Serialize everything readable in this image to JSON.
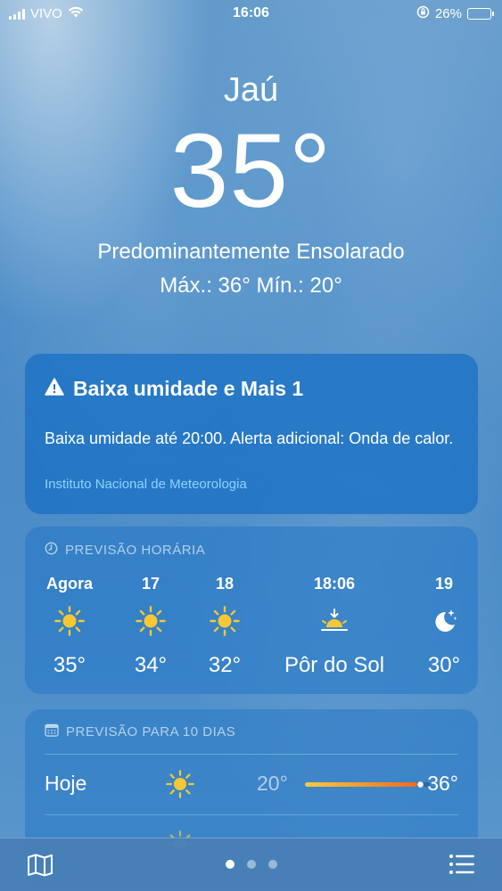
{
  "status_bar": {
    "carrier": "VIVO",
    "time": "16:06",
    "battery_percent": "26%",
    "battery_level": 0.26,
    "icons": [
      "signal-icon",
      "wifi-icon",
      "rotation-lock-icon",
      "battery-icon"
    ]
  },
  "header": {
    "city": "Jaú",
    "temperature": "35°",
    "condition": "Predominantemente Ensolarado",
    "high_low": "Máx.: 36°  Mín.: 20°"
  },
  "alert": {
    "icon": "warning-icon",
    "title": "Baixa umidade e Mais 1",
    "body": "Baixa umidade até 20:00. Alerta adicional: Onda de calor.",
    "source": "Instituto Nacional de Meteorologia"
  },
  "hourly": {
    "label": "PREVISÃO HORÁRIA",
    "icon": "clock-icon",
    "items": [
      {
        "time": "Agora",
        "icon": "sun-icon",
        "temp": "35°"
      },
      {
        "time": "17",
        "icon": "sun-icon",
        "temp": "34°"
      },
      {
        "time": "18",
        "icon": "sun-icon",
        "temp": "32°"
      },
      {
        "time": "18:06",
        "icon": "sunset-icon",
        "temp": "Pôr do Sol"
      },
      {
        "time": "19",
        "icon": "moon-stars-icon",
        "temp": "30°"
      }
    ]
  },
  "daily": {
    "label": "PREVISÃO PARA 10 DIAS",
    "icon": "calendar-icon",
    "days": [
      {
        "day": "Hoje",
        "icon": "sun-icon",
        "min": "20°",
        "max": "36°",
        "range_start": 0.0,
        "range_end": 0.9,
        "current": 0.92
      }
    ]
  },
  "colors": {
    "sun": "#f7c733",
    "alert_source": "#8fd0ff",
    "battery": "#ffd60a"
  },
  "bottom_bar": {
    "page_count": 3,
    "active_page": 0,
    "icons": [
      "map-icon",
      "list-icon"
    ]
  }
}
